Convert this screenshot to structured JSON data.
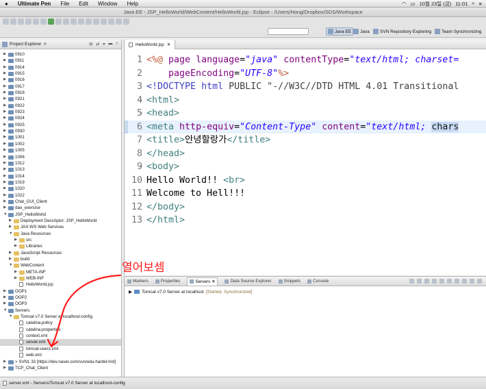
{
  "menubar": {
    "app": "Ultimate Pen",
    "items": [
      "File",
      "Edit",
      "Window",
      "Help"
    ],
    "date": "10월 23일 (금)",
    "time": "11:01"
  },
  "window": {
    "title": "Java EE - JSP_HelloWorld/WebContent/HelloWorld.jsp - Eclipse - /Users/Hong/Dropbox/SDS/Workspace"
  },
  "perspectives": [
    "Java EE",
    "Java",
    "SVN Repository Exploring",
    "Team Synchronizing"
  ],
  "project_explorer": {
    "title": "Project Explorer",
    "nodes": [
      {
        "label": "0910",
        "level": 0
      },
      {
        "label": "0911",
        "level": 0
      },
      {
        "label": "0914",
        "level": 0
      },
      {
        "label": "0915",
        "level": 0
      },
      {
        "label": "0916",
        "level": 0
      },
      {
        "label": "0917",
        "level": 0
      },
      {
        "label": "0918",
        "level": 0
      },
      {
        "label": "0921",
        "level": 0
      },
      {
        "label": "0922",
        "level": 0
      },
      {
        "label": "0923",
        "level": 0
      },
      {
        "label": "0924",
        "level": 0
      },
      {
        "label": "0925",
        "level": 0
      },
      {
        "label": "0930",
        "level": 0
      },
      {
        "label": "1001",
        "level": 0
      },
      {
        "label": "1002",
        "level": 0
      },
      {
        "label": "1005",
        "level": 0
      },
      {
        "label": "1006",
        "level": 0
      },
      {
        "label": "1012",
        "level": 0
      },
      {
        "label": "1013",
        "level": 0
      },
      {
        "label": "1014",
        "level": 0
      },
      {
        "label": "1019",
        "level": 0
      },
      {
        "label": "1020",
        "level": 0
      },
      {
        "label": "1022",
        "level": 0
      },
      {
        "label": "Chat_GUI_Client",
        "level": 0
      },
      {
        "label": "dao_exercise",
        "level": 0
      },
      {
        "label": "JSP_HelloWorld",
        "level": 0,
        "open": true
      },
      {
        "label": "Deployment Descriptor: JSP_HelloWorld",
        "level": 1
      },
      {
        "label": "JAX-WS Web Services",
        "level": 1
      },
      {
        "label": "Java Resources",
        "level": 1,
        "open": true
      },
      {
        "label": "src",
        "level": 2
      },
      {
        "label": "Libraries",
        "level": 2
      },
      {
        "label": "JavaScript Resources",
        "level": 1
      },
      {
        "label": "build",
        "level": 1
      },
      {
        "label": "WebContent",
        "level": 1,
        "open": true
      },
      {
        "label": "META-INF",
        "level": 2
      },
      {
        "label": "WEB-INF",
        "level": 2
      },
      {
        "label": "HelloWorld.jsp",
        "level": 2,
        "file": true
      },
      {
        "label": "OOP1",
        "level": 0
      },
      {
        "label": "OOP2",
        "level": 0
      },
      {
        "label": "OOP3",
        "level": 0
      },
      {
        "label": "Servers",
        "level": 0,
        "open": true
      },
      {
        "label": "Tomcat v7.0 Server at localhost-config",
        "level": 1,
        "open": true
      },
      {
        "label": "catalina.policy",
        "level": 2,
        "file": true
      },
      {
        "label": "catalina.properties",
        "level": 2,
        "file": true
      },
      {
        "label": "context.xml",
        "level": 2,
        "file": true
      },
      {
        "label": "server.xml",
        "level": 2,
        "file": true,
        "selected": true
      },
      {
        "label": "tomcat-users.xml",
        "level": 2,
        "file": true
      },
      {
        "label": "web.xml",
        "level": 2,
        "file": true
      },
      {
        "label": "> SVN1 33 [https://dev.naver.com/svn/edu-hanbit-hrd]",
        "level": 0
      },
      {
        "label": "TCP_Chat_Client",
        "level": 0
      }
    ]
  },
  "editor": {
    "tab": "HelloWorld.jsp",
    "lines": [
      {
        "no": "1",
        "fold": "",
        "parts": [
          [
            "dir",
            "<%@ "
          ],
          [
            "at",
            "page "
          ],
          [
            "at",
            "language"
          ],
          [
            "t0",
            "="
          ],
          [
            "s",
            "\"java\""
          ],
          [
            "t0",
            " "
          ],
          [
            "at",
            "contentType"
          ],
          [
            "t0",
            "="
          ],
          [
            "s",
            "\"text/html; charset="
          ]
        ]
      },
      {
        "no": "2",
        "fold": "",
        "parts": [
          [
            "t0",
            "    "
          ],
          [
            "at",
            "pageEncoding"
          ],
          [
            "t0",
            "="
          ],
          [
            "s",
            "\"UTF-8\""
          ],
          [
            "dir",
            "%>"
          ]
        ]
      },
      {
        "no": "3",
        "fold": "",
        "parts": [
          [
            "pk",
            "<!DOCTYPE "
          ],
          [
            "pk",
            "html "
          ],
          [
            "doc",
            "PUBLIC "
          ],
          [
            "doc",
            "\"-//W3C//DTD HTML 4.01 Transitional"
          ]
        ]
      },
      {
        "no": "4",
        "fold": "⊖",
        "parts": [
          [
            "k",
            "<html>"
          ]
        ]
      },
      {
        "no": "5",
        "fold": "⊖",
        "parts": [
          [
            "k",
            "<head>"
          ]
        ]
      },
      {
        "no": "6",
        "fold": "",
        "cur": true,
        "parts": [
          [
            "k",
            "<meta "
          ],
          [
            "at",
            "http-equiv"
          ],
          [
            "t0",
            "="
          ],
          [
            "s",
            "\"Content-Type\""
          ],
          [
            "t0",
            " "
          ],
          [
            "at",
            "content"
          ],
          [
            "t0",
            "="
          ],
          [
            "s",
            "\"text/html; "
          ],
          [
            "hl",
            "chars"
          ]
        ]
      },
      {
        "no": "7",
        "fold": "",
        "parts": [
          [
            "k",
            "<title>"
          ],
          [
            "t0",
            "안녕할랑가"
          ],
          [
            "k",
            "</title>"
          ]
        ]
      },
      {
        "no": "8",
        "fold": "",
        "parts": [
          [
            "k",
            "</head>"
          ]
        ]
      },
      {
        "no": "9",
        "fold": "⊖",
        "parts": [
          [
            "k",
            "<body>"
          ]
        ]
      },
      {
        "no": "10",
        "fold": "",
        "parts": [
          [
            "t0",
            "Hello World!! "
          ],
          [
            "k",
            "<br>"
          ]
        ]
      },
      {
        "no": "11",
        "fold": "",
        "parts": [
          [
            "t0",
            "Welcome to Hell!!!"
          ]
        ]
      },
      {
        "no": "12",
        "fold": "",
        "parts": [
          [
            "k",
            "</body>"
          ]
        ]
      },
      {
        "no": "13",
        "fold": "",
        "parts": [
          [
            "k",
            "</html>"
          ]
        ]
      }
    ]
  },
  "servers_panel": {
    "tabs": [
      "Markers",
      "Properties",
      "Servers",
      "Data Source Explorer",
      "Snippets",
      "Console"
    ],
    "active_tab": "Servers",
    "server_name": "Tomcat v7.0 Server at localhost",
    "server_status": "[Started, Synchronized]"
  },
  "annotation": {
    "text": "열어보셈",
    "color": "#ff1a1a"
  },
  "statusbar": {
    "text": "server.xml - Servers/Tomcat v7.0 Server at localhost-config"
  }
}
